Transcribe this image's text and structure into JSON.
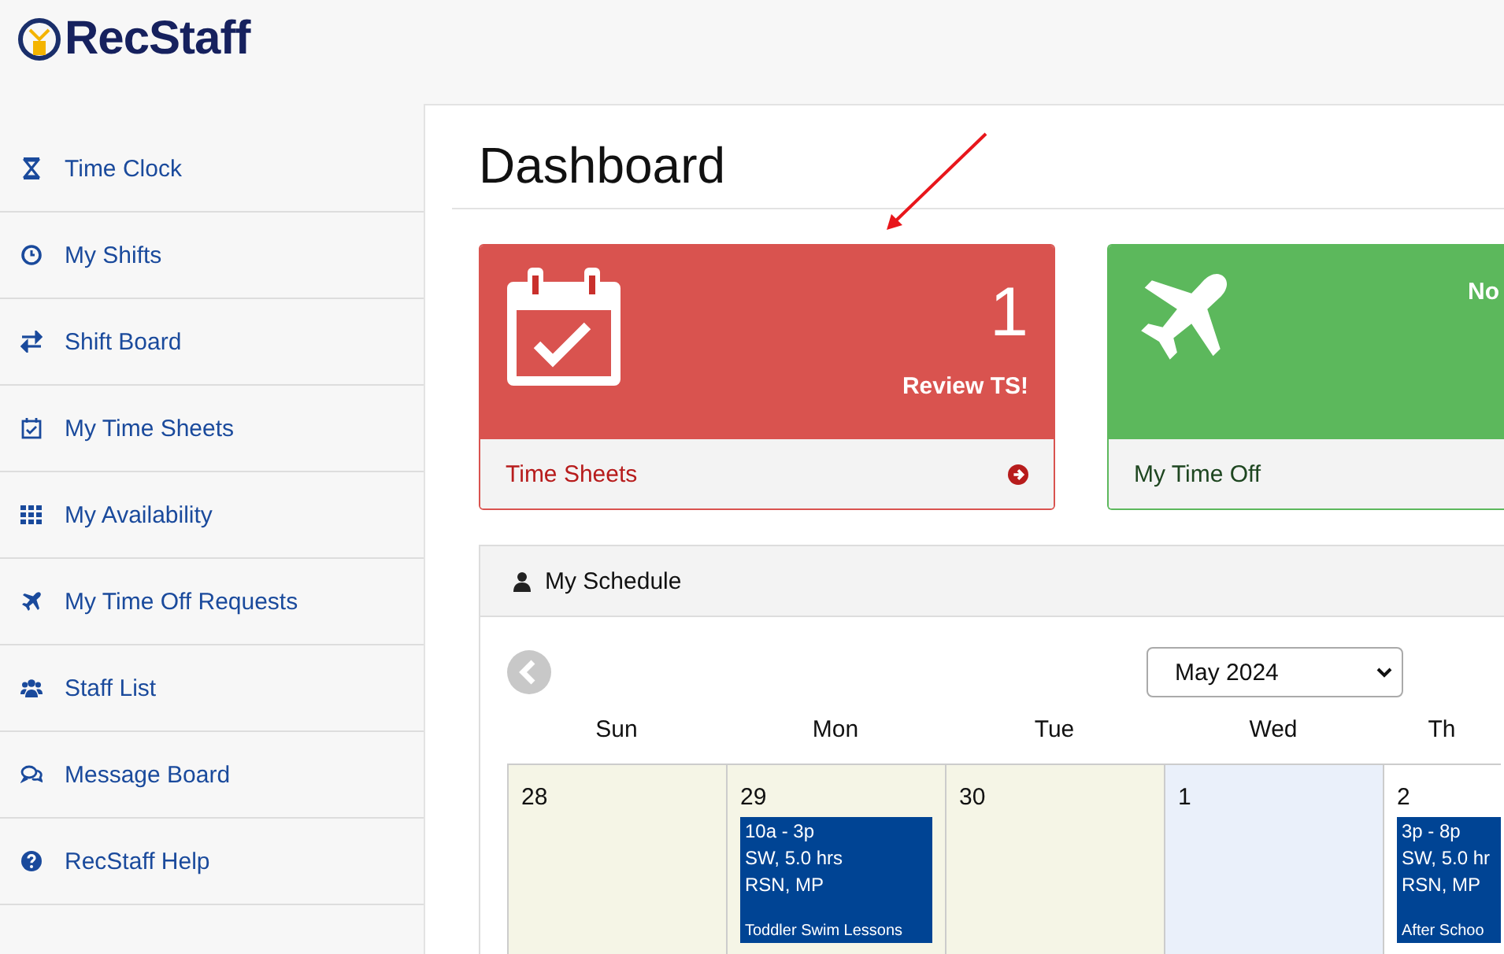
{
  "logo": {
    "text": "RecStaff"
  },
  "sidebar": {
    "items": [
      {
        "label": "Time Clock",
        "kind": "hourglass"
      },
      {
        "label": "My Shifts",
        "kind": "clock"
      },
      {
        "label": "Shift Board",
        "kind": "exchange"
      },
      {
        "label": "My Time Sheets",
        "kind": "calendar"
      },
      {
        "label": "My Availability",
        "kind": "grid"
      },
      {
        "label": "My Time Off Requests",
        "kind": "plane"
      },
      {
        "label": "Staff List",
        "kind": "users"
      },
      {
        "label": "Message Board",
        "kind": "comments"
      },
      {
        "label": "RecStaff Help",
        "kind": "help"
      }
    ]
  },
  "page_title": "Dashboard",
  "cards": [
    {
      "kind": "time-sheets",
      "color": "#d9534f",
      "count": "1",
      "message": "Review TS!",
      "footer": "Time Sheets"
    },
    {
      "kind": "time-off",
      "color": "#5cb85c",
      "message": "No",
      "footer": "My Time Off"
    }
  ],
  "schedule": {
    "title": "My Schedule",
    "month": "May 2024",
    "weekdays": [
      "Sun",
      "Mon",
      "Tue",
      "Wed",
      "Th"
    ],
    "days": [
      {
        "date": "28",
        "past": true,
        "today": false
      },
      {
        "date": "29",
        "past": true,
        "today": false,
        "events": [
          {
            "time": "10a - 3p",
            "hours": "SW, 5.0 hrs",
            "location": "RSN, MP",
            "name": "Toddler Swim Lessons"
          }
        ]
      },
      {
        "date": "30",
        "past": true,
        "today": false
      },
      {
        "date": "1",
        "past": false,
        "today": true
      },
      {
        "date": "2",
        "past": false,
        "today": false,
        "events": [
          {
            "time": "3p - 8p",
            "hours": "SW, 5.0 hr",
            "location": "RSN, MP",
            "name": "After Schoo"
          }
        ]
      }
    ]
  }
}
